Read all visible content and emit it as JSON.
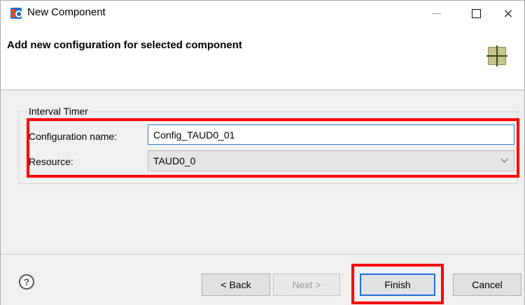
{
  "window": {
    "title": "New Component",
    "icon": "renesas-smart-configurator-icon",
    "controls": {
      "minimize_icon": "minimize-icon",
      "maximize_icon": "maximize-icon",
      "close_glyph": "×"
    }
  },
  "header": {
    "title": "Add new configuration for selected component",
    "icon": "component-grid-icon"
  },
  "group": {
    "legend": "Interval Timer",
    "configuration_name": {
      "label": "Configuration name:",
      "value": "Config_TAUD0_01"
    },
    "resource": {
      "label": "Resource:",
      "selected": "TAUD0_0"
    }
  },
  "footer": {
    "help_glyph": "?",
    "buttons": {
      "back": "< Back",
      "next": "Next >",
      "finish": "Finish",
      "cancel": "Cancel"
    }
  },
  "colors": {
    "highlight": "#ff0000",
    "focus_border": "#2f7bd6",
    "dialog_background": "#f0f0f0"
  }
}
